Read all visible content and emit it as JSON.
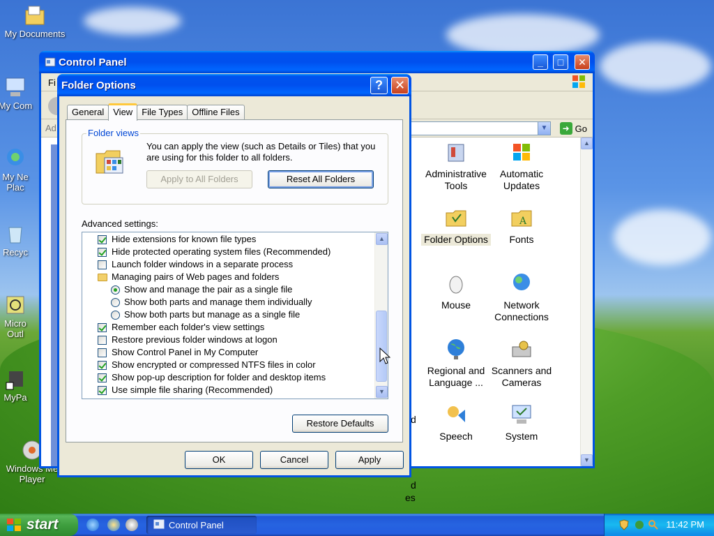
{
  "desktop": {
    "icons": [
      {
        "label": "My Documents"
      },
      {
        "label": "My Com"
      },
      {
        "label": "My Ne"
      },
      {
        "label": "Plac"
      },
      {
        "label": "Recyc"
      },
      {
        "label": "Micro"
      },
      {
        "label": "Outl"
      },
      {
        "label": "MyPa"
      },
      {
        "label": "Windows Me"
      },
      {
        "label": "Player"
      }
    ]
  },
  "control_panel": {
    "title": "Control Panel",
    "menu_fragment": "Fi",
    "address_fragment": "Ad",
    "go_label": "Go",
    "items": [
      {
        "label": "Administrative Tools"
      },
      {
        "label": "Automatic Updates"
      },
      {
        "label": "Folder Options"
      },
      {
        "label": "Fonts"
      },
      {
        "label": "Mouse"
      },
      {
        "label": "Network Connections"
      },
      {
        "label": "Regional and Language ..."
      },
      {
        "label": "Scanners and Cameras"
      },
      {
        "label": "Speech"
      },
      {
        "label": "System"
      }
    ],
    "clipped_labels": [
      "d",
      "d",
      "es"
    ]
  },
  "dialog": {
    "title": "Folder Options",
    "help_label": "?",
    "tabs": [
      {
        "label": "General"
      },
      {
        "label": "View"
      },
      {
        "label": "File Types"
      },
      {
        "label": "Offline Files"
      }
    ],
    "folder_views": {
      "group_label": "Folder views",
      "description": "You can apply the view (such as Details or Tiles) that you are using for this folder to all folders.",
      "apply_all_label": "Apply to All Folders",
      "reset_all_label": "Reset All Folders"
    },
    "advanced_label": "Advanced settings:",
    "advanced_items": [
      {
        "type": "checkbox",
        "checked": true,
        "indent": 1,
        "label": "Hide extensions for known file types"
      },
      {
        "type": "checkbox",
        "checked": true,
        "indent": 1,
        "label": "Hide protected operating system files (Recommended)"
      },
      {
        "type": "checkbox",
        "checked": false,
        "indent": 1,
        "label": "Launch folder windows in a separate process"
      },
      {
        "type": "folder",
        "checked": false,
        "indent": 1,
        "label": "Managing pairs of Web pages and folders"
      },
      {
        "type": "radio",
        "checked": true,
        "indent": 2,
        "label": "Show and manage the pair as a single file"
      },
      {
        "type": "radio",
        "checked": false,
        "indent": 2,
        "label": "Show both parts and manage them individually"
      },
      {
        "type": "radio",
        "checked": false,
        "indent": 2,
        "label": "Show both parts but manage as a single file"
      },
      {
        "type": "checkbox",
        "checked": true,
        "indent": 1,
        "label": "Remember each folder's view settings"
      },
      {
        "type": "checkbox",
        "checked": false,
        "indent": 1,
        "label": "Restore previous folder windows at logon"
      },
      {
        "type": "checkbox",
        "checked": false,
        "indent": 1,
        "label": "Show Control Panel in My Computer"
      },
      {
        "type": "checkbox",
        "checked": true,
        "indent": 1,
        "label": "Show encrypted or compressed NTFS files in color"
      },
      {
        "type": "checkbox",
        "checked": true,
        "indent": 1,
        "label": "Show pop-up description for folder and desktop items"
      },
      {
        "type": "checkbox",
        "checked": true,
        "indent": 1,
        "label": "Use simple file sharing (Recommended)"
      }
    ],
    "restore_defaults_label": "Restore Defaults",
    "ok_label": "OK",
    "cancel_label": "Cancel",
    "apply_label": "Apply"
  },
  "taskbar": {
    "start_label": "start",
    "task_label": "Control Panel",
    "clock": "11:42 PM"
  },
  "colors": {
    "xp_blue": "#0054e3",
    "start_green": "#3f9f3f",
    "check_green": "#21a121",
    "group_blue": "#0046d5"
  }
}
